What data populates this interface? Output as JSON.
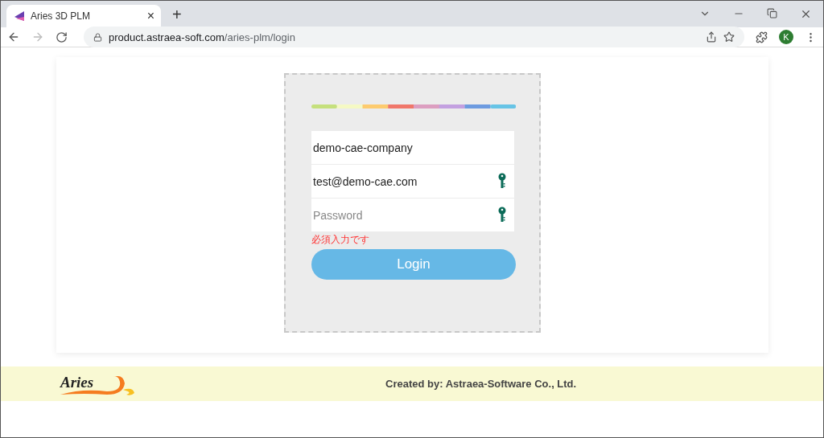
{
  "browser": {
    "tab": {
      "title": "Aries 3D PLM",
      "close": "×"
    },
    "new_tab": "+",
    "url": {
      "host": "product.astraea-soft.com",
      "path": "/aries-plm/login"
    },
    "profile": "K"
  },
  "login": {
    "fields": [
      {
        "kind": "plain",
        "value": "demo-cae-company"
      },
      {
        "kind": "key",
        "value": "test@demo-cae.com"
      },
      {
        "kind": "key",
        "placeholder": "Password"
      }
    ],
    "error": "必須入力です",
    "button": "Login"
  },
  "footer": {
    "logo": "Aries",
    "credit": "Created by: Astraea-Software Co., Ltd."
  }
}
